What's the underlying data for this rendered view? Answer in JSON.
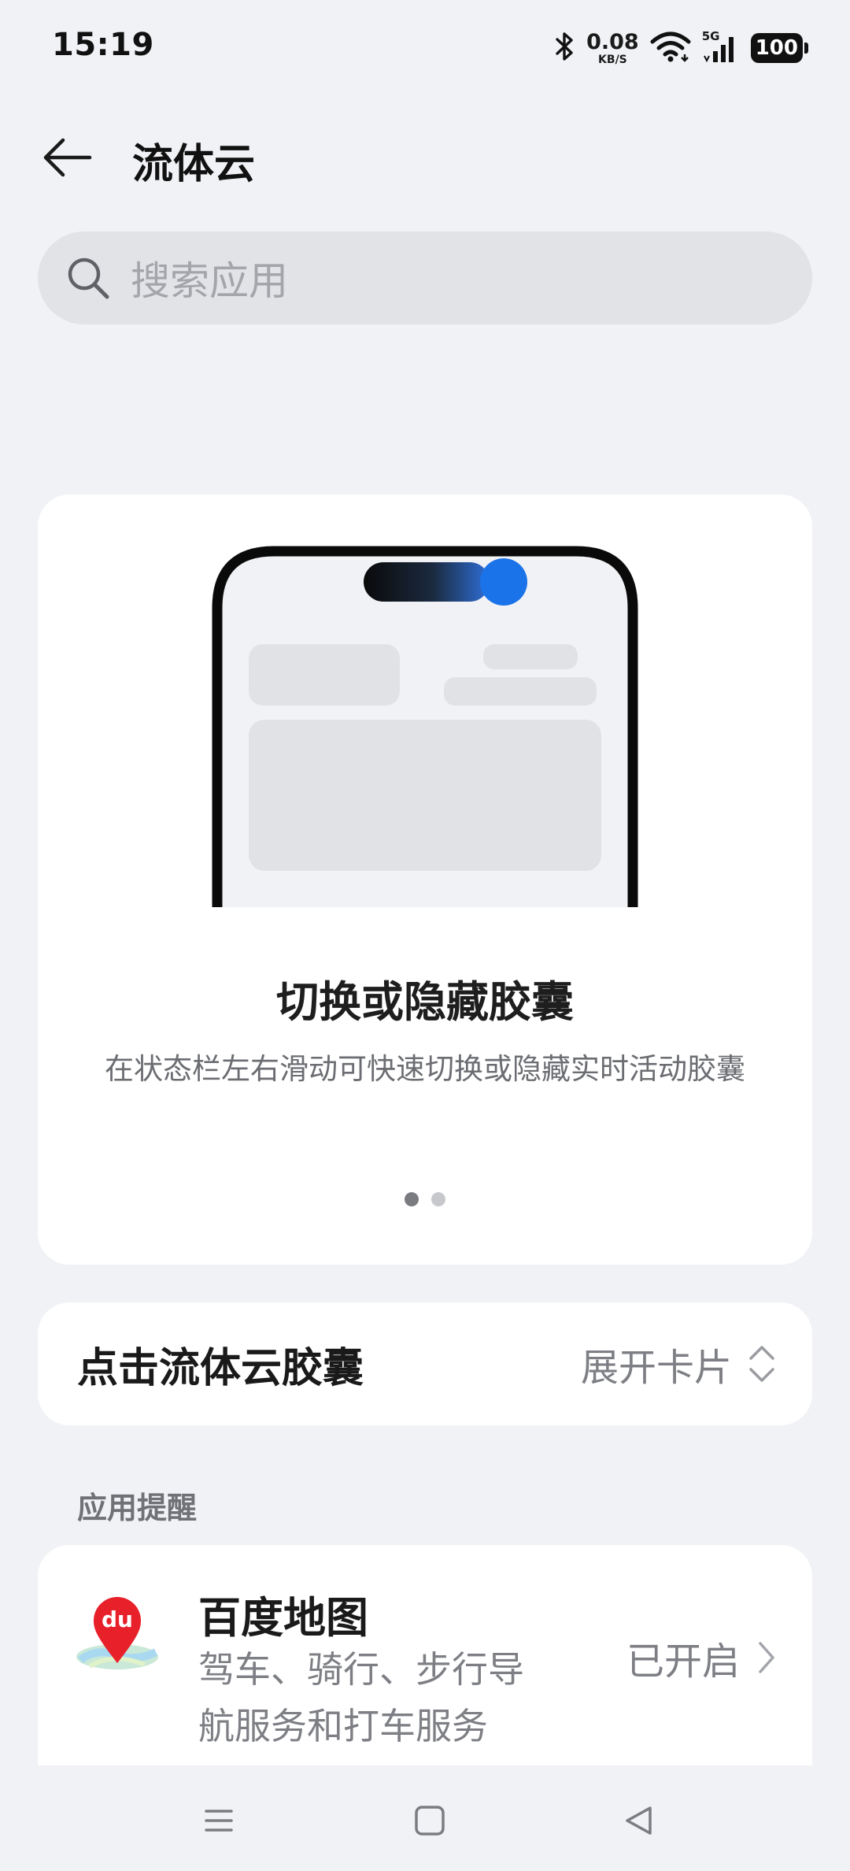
{
  "status_bar": {
    "time": "15:19",
    "net_speed_value": "0.08",
    "net_speed_unit": "KB/S",
    "signal_type": "5G",
    "battery": "100",
    "icons": [
      "bluetooth-icon",
      "wifi-icon",
      "cellular-signal-icon",
      "battery-icon"
    ]
  },
  "header": {
    "title": "流体云"
  },
  "search": {
    "placeholder": "搜索应用"
  },
  "intro_card": {
    "title": "切换或隐藏胶囊",
    "description": "在状态栏左右滑动可快速切换或隐藏实时活动胶囊",
    "page_index": 1,
    "page_count": 2
  },
  "click_setting": {
    "label": "点击流体云胶囊",
    "value": "展开卡片"
  },
  "app_section": {
    "title": "应用提醒",
    "apps": [
      {
        "name": "百度地图",
        "description": "驾车、骑行、步行导航服务和打车服务",
        "status": "已开启",
        "icon_text": "du"
      }
    ]
  },
  "colors": {
    "background": "#f1f2f5",
    "card": "#ffffff",
    "accent_blue": "#1a73e8",
    "baidu_red": "#e8202a"
  }
}
